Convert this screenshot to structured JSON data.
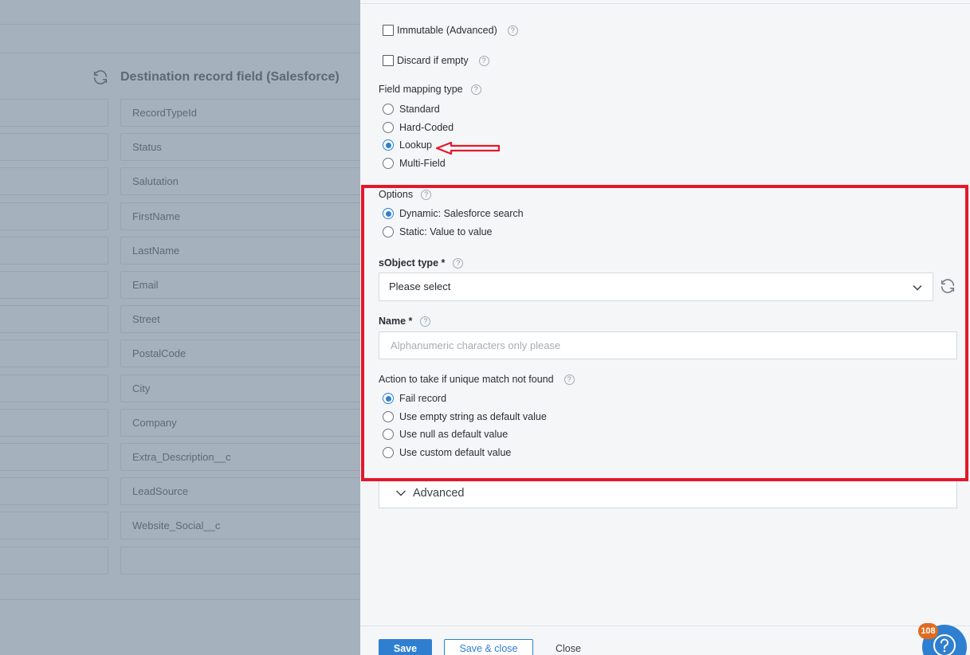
{
  "background": {
    "header_title": "Destination record field (Salesforce)",
    "fields": [
      "RecordTypeId",
      "Status",
      "Salutation",
      "FirstName",
      "LastName",
      "Email",
      "Street",
      "PostalCode",
      "City",
      "Company",
      "Extra_Description__c",
      "LeadSource",
      "Website_Social__c",
      ""
    ]
  },
  "drawer": {
    "immutable_label": "Immutable (Advanced)",
    "discard_label": "Discard if empty",
    "help_glyph": "?",
    "mapping_type": {
      "label": "Field mapping type",
      "options": [
        "Standard",
        "Hard-Coded",
        "Lookup",
        "Multi-Field"
      ],
      "selected": "Lookup"
    },
    "options": {
      "label": "Options",
      "choices": [
        "Dynamic: Salesforce search",
        "Static: Value to value"
      ],
      "selected": "Dynamic: Salesforce search"
    },
    "sobject": {
      "label": "sObject type *",
      "value": "Please select"
    },
    "name": {
      "label": "Name *",
      "value": "",
      "placeholder": "Alphanumeric characters only please"
    },
    "action": {
      "label": "Action to take if unique match not found",
      "choices": [
        "Fail record",
        "Use empty string as default value",
        "Use null as default value",
        "Use custom default value"
      ],
      "selected": "Fail record"
    },
    "advanced_label": "Advanced"
  },
  "footer": {
    "save_label": "Save",
    "save_close_label": "Save & close",
    "close_label": "Close"
  },
  "help_widget": {
    "badge_count": "108"
  },
  "colors": {
    "accent": "#2f7fd1",
    "annotation": "#e3192b",
    "badge": "#e06b1f",
    "overlay": "#a5b1bd"
  }
}
